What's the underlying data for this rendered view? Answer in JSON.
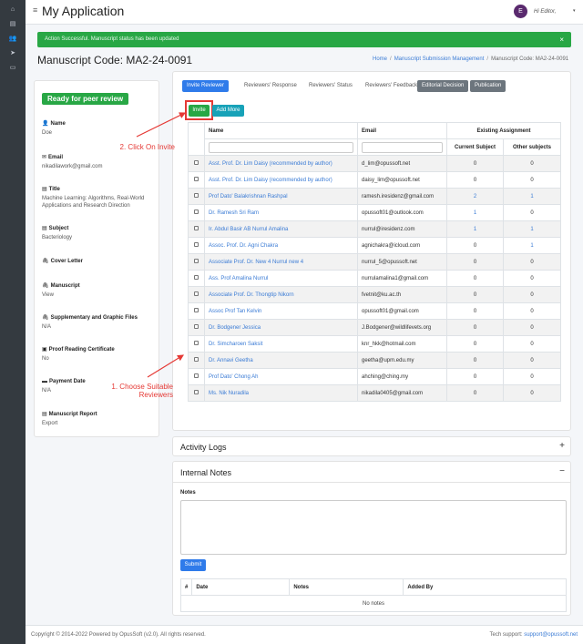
{
  "app": {
    "title": "My Application"
  },
  "user": {
    "initial": "E",
    "name": "Hi Editor,",
    "caret": "▾"
  },
  "alert": {
    "message": "Action Successful. Manuscript status has been updated",
    "close": "×"
  },
  "page": {
    "title": "Manuscript Code: MA2-24-0091"
  },
  "breadcrumb": [
    "Home",
    "Manuscript Submission Management",
    "Manuscript Code: MA2-24-0091"
  ],
  "status": {
    "badge": "Ready for peer review"
  },
  "info": [
    {
      "icon": "person-icon",
      "glyph": "👤",
      "label": "Name",
      "value": "Doe",
      "link": false
    },
    {
      "icon": "envelope-icon",
      "glyph": "✉",
      "label": "Email",
      "value": "nikadilawork@gmail.com",
      "link": false
    },
    {
      "icon": "book-icon",
      "glyph": "▤",
      "label": "Title",
      "value": "Machine Learning: Algorithms, Real-World Applications and Research Direction",
      "link": false
    },
    {
      "icon": "book-icon",
      "glyph": "▤",
      "label": "Subject",
      "value": "Bacteriology",
      "link": false
    },
    {
      "icon": "paperclip-icon",
      "glyph": "🖇",
      "label": "Cover Letter",
      "value": "",
      "link": false
    },
    {
      "icon": "paperclip-icon",
      "glyph": "🖇",
      "label": "Manuscript",
      "value": "View",
      "link": true
    },
    {
      "icon": "paperclip-icon",
      "glyph": "🖇",
      "label": "Supplementary and Graphic Files",
      "value": "N/A",
      "link": false
    },
    {
      "icon": "image-icon",
      "glyph": "▣",
      "label": "Proof Reading Certificate",
      "value": "No",
      "link": false
    },
    {
      "icon": "money-icon",
      "glyph": "▬",
      "label": "Payment Date",
      "value": "N/A",
      "link": false
    },
    {
      "icon": "report-icon",
      "glyph": "▤",
      "label": "Manuscript Report",
      "value": "Export",
      "link": true
    }
  ],
  "tabs": [
    "Invite Reviewer",
    "Reviewers' Response",
    "Reviewers' Status",
    "Reviewers' Feedback",
    "Editorial Decision",
    "Publication"
  ],
  "buttons": {
    "invite": "Invite",
    "add_more": "Add More",
    "submit": "Submit"
  },
  "table": {
    "headers": {
      "name": "Name",
      "email": "Email",
      "existing": "Existing Assignment",
      "current": "Current Subject",
      "other": "Other subjects"
    },
    "rows": [
      {
        "name": "Asst. Prof. Dr. Lim Daisy (recommended by author)",
        "email": "d_lim@opussoft.net",
        "current": "0",
        "other": "0"
      },
      {
        "name": "Asst. Prof. Dr. Lim Daisy (recommended by author)",
        "email": "daisy_lim@opussoft.net",
        "current": "0",
        "other": "0"
      },
      {
        "name": "Prof Dato' Balakrishnan Rashpal",
        "email": "ramesh.iresidenz@gmail.com",
        "current": "2",
        "other": "1"
      },
      {
        "name": "Dr. Ramesh Sri Ram",
        "email": "opussoft01@outlook.com",
        "current": "1",
        "other": "0"
      },
      {
        "name": "Ir. Abdul Basir AB Nurrul Amalina",
        "email": "nurrul@iresidenz.com",
        "current": "1",
        "other": "1"
      },
      {
        "name": "Assoc. Prof. Dr. Agni Chakra",
        "email": "agnichakra@icloud.com",
        "current": "0",
        "other": "1"
      },
      {
        "name": "Associate Prof. Dr. New 4 Nurrul new 4",
        "email": "nurrul_5@opussoft.net",
        "current": "0",
        "other": "0"
      },
      {
        "name": "Ass. Prof Amalina Nurrul",
        "email": "nurrulamalina1@gmail.com",
        "current": "0",
        "other": "0"
      },
      {
        "name": "Associate Prof. Dr. Thongtip Nikorn",
        "email": "fvetnit@ku.ac.th",
        "current": "0",
        "other": "0"
      },
      {
        "name": "Assoc Prof Tan Kelvin",
        "email": "opussoft01@gmail.com",
        "current": "0",
        "other": "0"
      },
      {
        "name": "Dr. Bodgener Jessica",
        "email": "J.Bodgener@wildlifevets.org",
        "current": "0",
        "other": "0"
      },
      {
        "name": "Dr. Simcharoen Saksit",
        "email": "knr_hkk@hotmail.com",
        "current": "0",
        "other": "0"
      },
      {
        "name": "Dr. Annavi Geetha",
        "email": "geetha@upm.edu.my",
        "current": "0",
        "other": "0"
      },
      {
        "name": "Prof Dato' Chong Ah",
        "email": "ahching@ching.my",
        "current": "0",
        "other": "0"
      },
      {
        "name": "Ms. Nik Nuradila",
        "email": "nikadila0405@gmail.com",
        "current": "0",
        "other": "0"
      }
    ]
  },
  "annotations": {
    "step1": "1. Choose Suitable Reviewers",
    "step2": "2. Click On Invite"
  },
  "activity": {
    "title": "Activity Logs",
    "tool": "+"
  },
  "notes": {
    "title": "Internal Notes",
    "tool": "−",
    "label": "Notes",
    "headers": [
      "#",
      "Date",
      "Notes",
      "Added By"
    ],
    "empty": "No notes"
  },
  "footer": {
    "left": "Copyright © 2014-2022 Powered by OpusSoft (v2.0). All rights reserved.",
    "right_prefix": "Tech support: ",
    "right_link": "support@opussoft.net"
  },
  "colors": {
    "accent": "#2f7bea",
    "success": "#28a745",
    "info": "#17a2b8",
    "annotation": "#e53935",
    "sidebar": "#343a40"
  }
}
